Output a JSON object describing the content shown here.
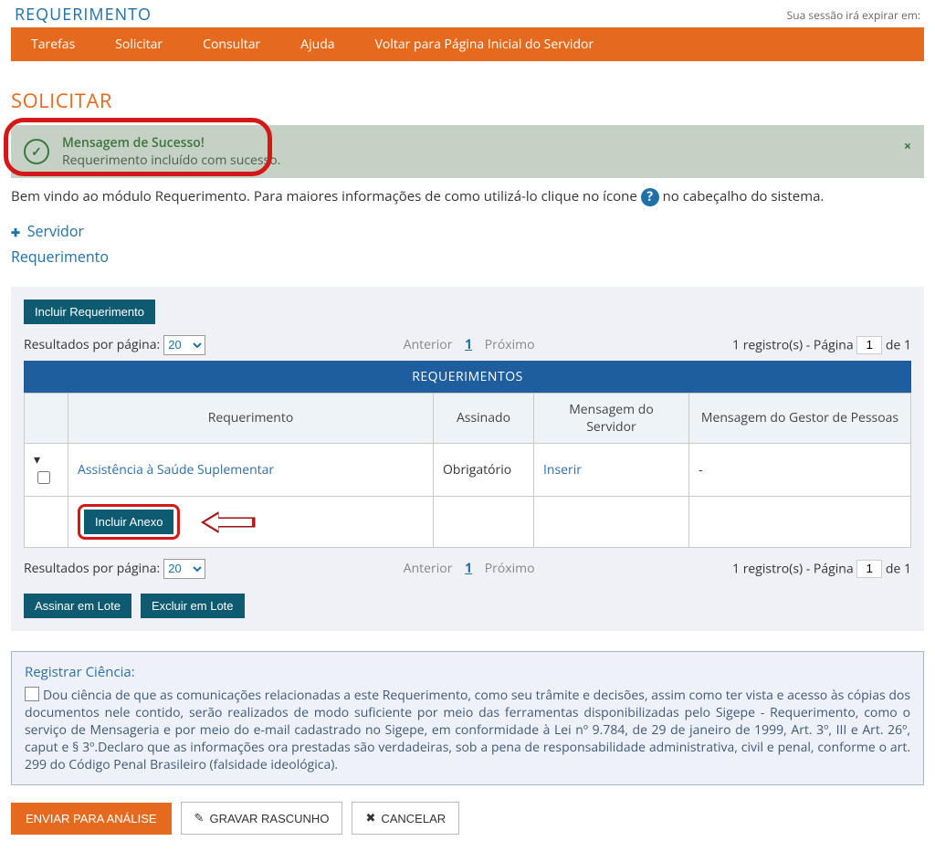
{
  "app_title": "REQUERIMENTO",
  "session_text": "Sua sessão irá expirar em:",
  "nav": [
    "Tarefas",
    "Solicitar",
    "Consultar",
    "Ajuda",
    "Voltar para Página Inicial do Servidor"
  ],
  "page_title": "SOLICITAR",
  "success": {
    "title": "Mensagem de Sucesso!",
    "message": "Requerimento incluído com sucesso."
  },
  "help_line_prefix": "Bem vindo ao módulo Requerimento. Para maiores informações de como utilizá-lo clique no ícone ",
  "help_line_suffix": " no cabeçalho do sistema.",
  "servidor_label": "Servidor",
  "requerimento_section": "Requerimento",
  "btn_incluir_req": "Incluir Requerimento",
  "rpp_label": "Resultados por página:",
  "rpp_value": "20",
  "pager_prev": "Anterior",
  "pager_page": "1",
  "pager_next": "Próximo",
  "pager_summary_prefix": "1 registro(s) - Página ",
  "pager_summary_suffix": " de 1",
  "page_input_value": "1",
  "table_band": "REQUERIMENTOS",
  "columns": {
    "c0": "",
    "c1": "Requerimento",
    "c2": "Assinado",
    "c3": "Mensagem do Servidor",
    "c4": "Mensagem do Gestor de Pessoas"
  },
  "row1": {
    "req_link": "Assistência à Saúde Suplementar",
    "assinado": "Obrigatório",
    "msg_servidor": "Inserir",
    "msg_gestor": "-"
  },
  "btn_incluir_anexo": "Incluir Anexo",
  "btn_assinar_lote": "Assinar em Lote",
  "btn_excluir_lote": "Excluir em Lote",
  "ciencia_title": "Registrar Ciência:",
  "ciencia_text": "Dou ciência de que as comunicações relacionadas a este Requerimento, como seu trâmite e decisões, assim como ter vista e acesso às cópias dos documentos nele contido, serão realizados de modo suficiente por meio das ferramentas disponibilizadas pelo Sigepe - Requerimento, como o serviço de Mensageria e por meio do e-mail cadastrado no Sigepe, em conformidade à Lei nº 9.784, de 29 de janeiro de 1999, Art. 3º, III e Art. 26º, caput e § 3º.Declaro que as informações ora prestadas são verdadeiras, sob a pena de responsabilidade administrativa, civil e penal, conforme o art. 299 do Código Penal Brasileiro (falsidade ideológica).",
  "btn_enviar": "ENVIAR PARA ANÁLISE",
  "btn_gravar": "GRAVAR RASCUNHO",
  "btn_cancelar": "CANCELAR"
}
